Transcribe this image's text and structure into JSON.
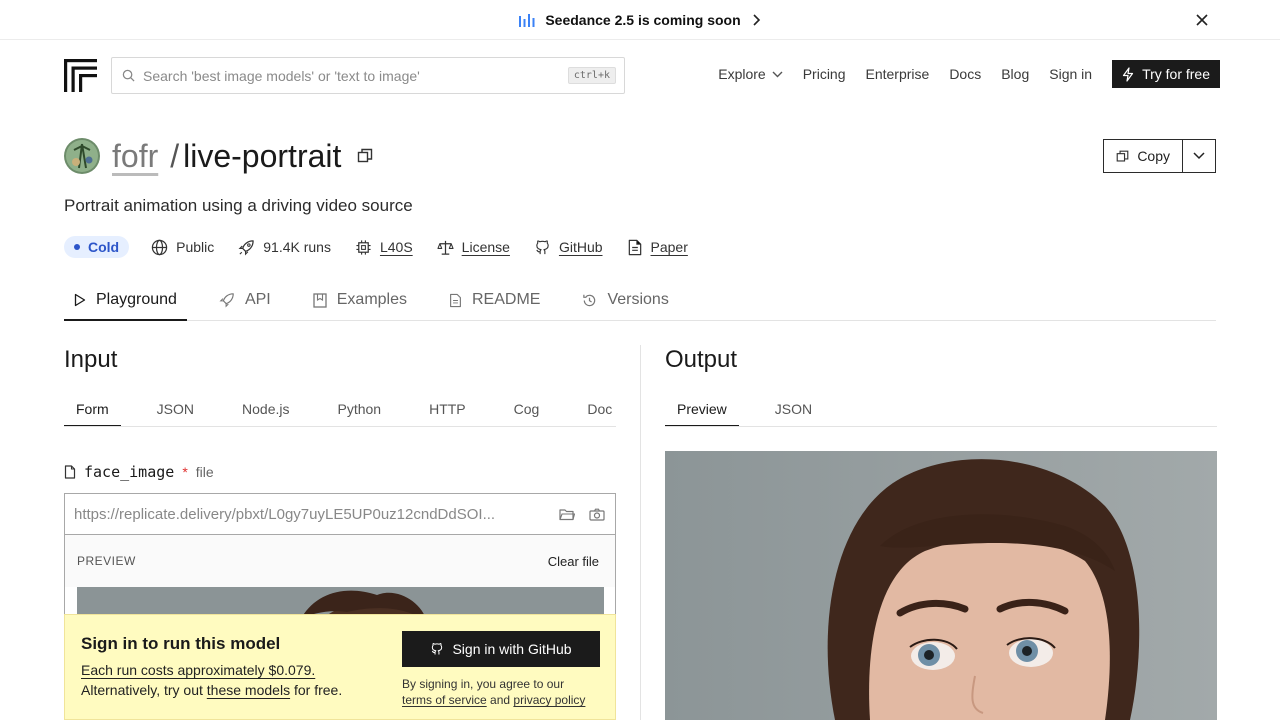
{
  "announcement": {
    "text": "Seedance 2.5 is coming soon"
  },
  "header": {
    "search_placeholder": "Search 'best image models' or 'text to image'",
    "search_shortcut": "ctrl+k",
    "nav": {
      "explore": "Explore",
      "pricing": "Pricing",
      "enterprise": "Enterprise",
      "docs": "Docs",
      "blog": "Blog",
      "sign_in": "Sign in",
      "try_free": "Try for free"
    }
  },
  "model": {
    "owner": "fofr",
    "slash": "/",
    "name": "live-portrait",
    "description": "Portrait animation using a driving video source",
    "copy_label": "Copy",
    "meta": {
      "status": "Cold",
      "visibility": "Public",
      "runs": "91.4K runs",
      "hardware": "L40S",
      "license": "License",
      "github": "GitHub",
      "paper": "Paper"
    },
    "status_color": "#2c55c9"
  },
  "tabs": [
    "Playground",
    "API",
    "Examples",
    "README",
    "Versions"
  ],
  "input": {
    "heading": "Input",
    "subtabs": [
      "Form",
      "JSON",
      "Node.js",
      "Python",
      "HTTP",
      "Cog",
      "Doc"
    ],
    "field": {
      "name": "face_image",
      "required_mark": "*",
      "type": "file",
      "value": "https://replicate.delivery/pbxt/L0gy7uyLE5UP0uz12cndDdSOI...",
      "preview_label": "PREVIEW",
      "clear_label": "Clear file"
    }
  },
  "output": {
    "heading": "Output",
    "subtabs": [
      "Preview",
      "JSON"
    ]
  },
  "signin_banner": {
    "title": "Sign in to run this model",
    "cost": "Each run costs approximately $0.079.",
    "alt_prefix": "Alternatively, try out ",
    "alt_link": "these models",
    "alt_suffix": " for free.",
    "button": "Sign in with GitHub",
    "terms_prefix": "By signing in, you agree to our",
    "terms_link": "terms of service",
    "terms_and": " and ",
    "privacy_link": "privacy policy"
  }
}
